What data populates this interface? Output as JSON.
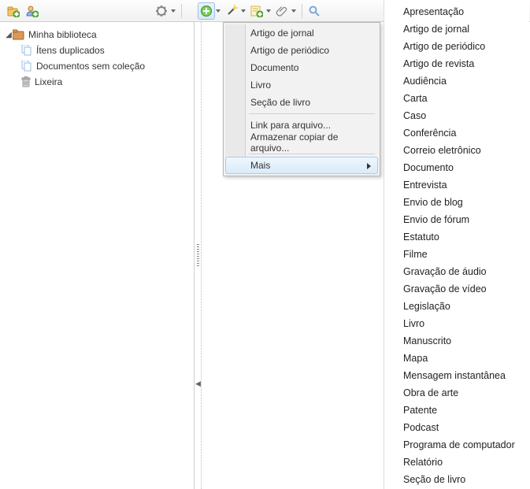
{
  "toolbar": {
    "new_collection": "new-collection",
    "new_group": "new-group",
    "actions": "actions",
    "new_item": "new-item",
    "wand": "wand",
    "note": "note",
    "attach": "attach",
    "search": "search"
  },
  "sidebar": {
    "library": "Minha biblioteca",
    "items": [
      {
        "icon": "duplicate-icon",
        "label": "Ítens duplicados"
      },
      {
        "icon": "unfiled-icon",
        "label": "Documentos sem coleção"
      },
      {
        "icon": "trash-icon",
        "label": "Lixeira"
      }
    ]
  },
  "menu": {
    "items_a": [
      "Artigo de jornal",
      "Artigo de periódico",
      "Documento",
      "Livro",
      "Seção de livro"
    ],
    "items_b": [
      "Link para arquivo...",
      "Armazenar copiar de arquivo..."
    ],
    "more": "Mais"
  },
  "submenu": {
    "items": [
      "Apresentação",
      "Artigo de jornal",
      "Artigo de periódico",
      "Artigo de revista",
      "Audiência",
      "Carta",
      "Caso",
      "Conferência",
      "Correio eletrônico",
      "Documento",
      "Entrevista",
      "Envio de blog",
      "Envio de fórum",
      "Estatuto",
      "Filme",
      "Gravação de áudio",
      "Gravação de vídeo",
      "Legislação",
      "Livro",
      "Manuscrito",
      "Mapa",
      "Mensagem instantânea",
      "Obra de arte",
      "Patente",
      "Podcast",
      "Programa de computador",
      "Relatório",
      "Seção de livro"
    ]
  }
}
